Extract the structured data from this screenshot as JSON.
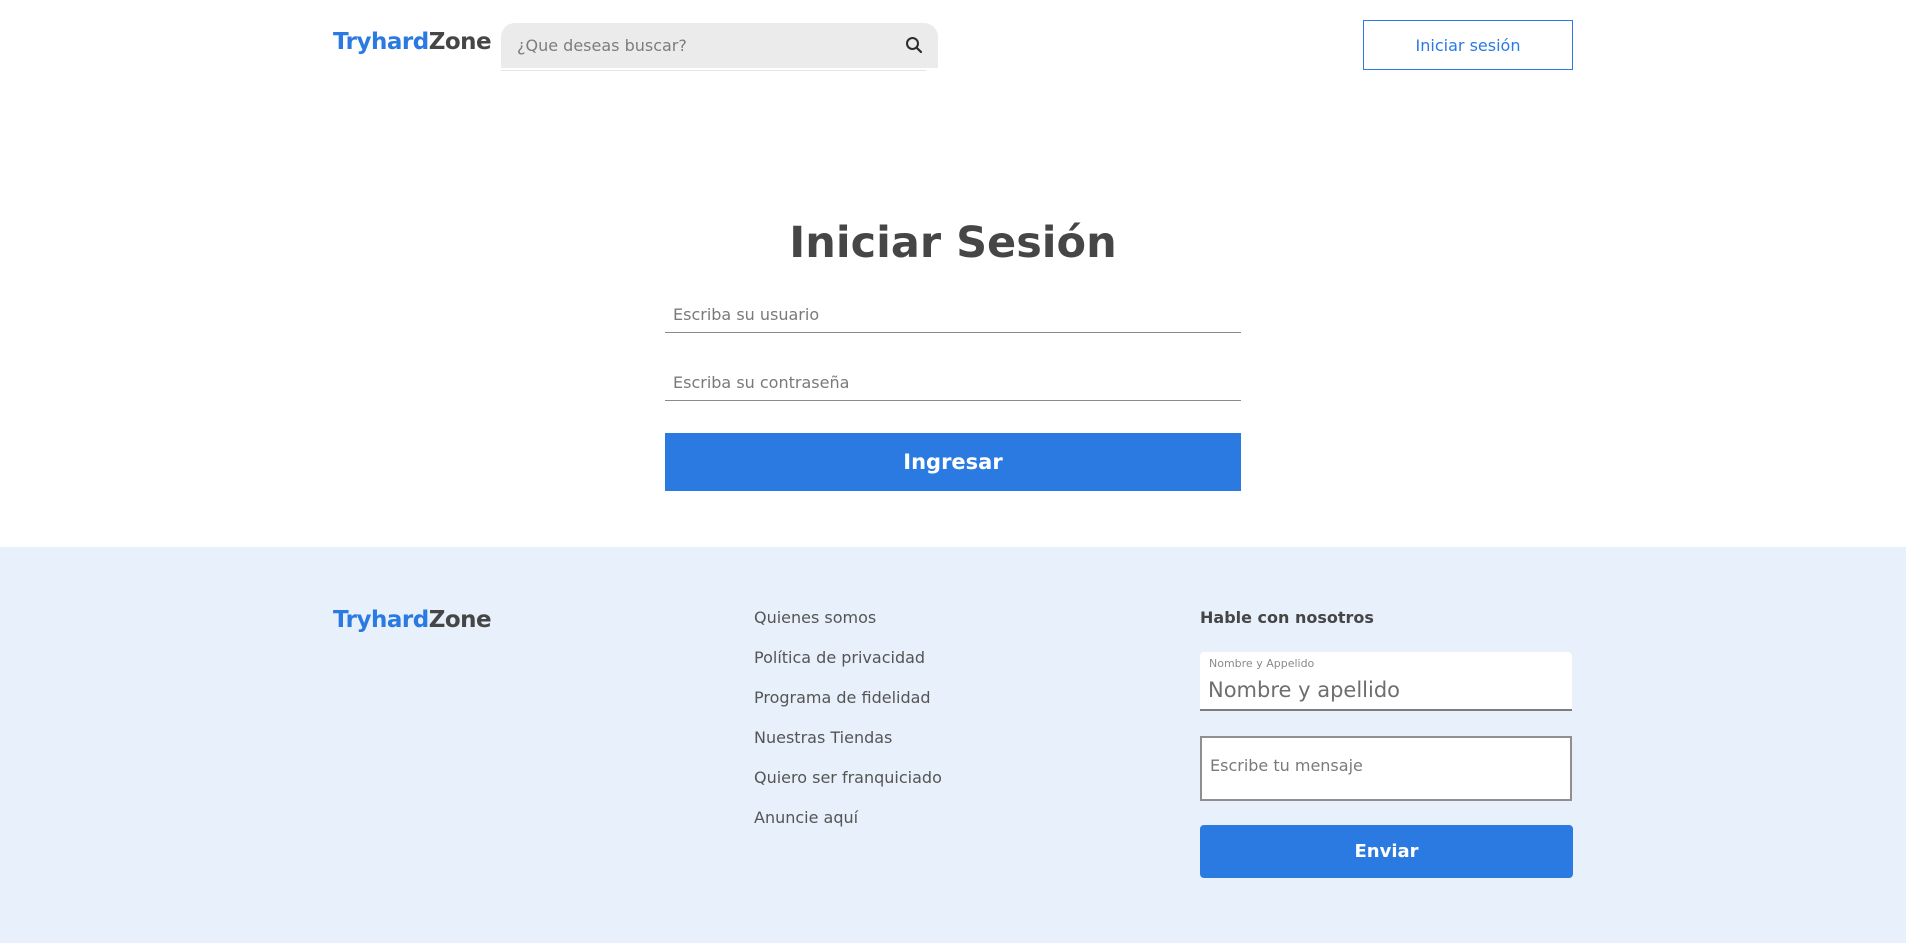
{
  "header": {
    "logo": {
      "part1": "Tryhard",
      "part2": "Zone"
    },
    "search": {
      "placeholder": "¿Que deseas buscar?",
      "icon": "search-icon"
    },
    "login_button": "Iniciar sesión"
  },
  "login": {
    "title": "Iniciar Sesión",
    "username_placeholder": "Escriba su usuario",
    "password_placeholder": "Escriba su contraseña",
    "submit_label": "Ingresar"
  },
  "footer": {
    "logo": {
      "part1": "Tryhard",
      "part2": "Zone"
    },
    "links": [
      "Quienes somos",
      "Política de privacidad",
      "Programa de fidelidad",
      "Nuestras Tiendas",
      "Quiero ser franquiciado",
      "Anuncie aquí"
    ],
    "contact": {
      "title": "Hable con nosotros",
      "name_label": "Nombre y Appelido",
      "name_placeholder": "Nombre y apellido",
      "message_placeholder": "Escribe tu mensaje",
      "send_label": "Enviar"
    }
  },
  "colors": {
    "accent": "#2a7ae2",
    "text": "#464646",
    "footer_bg": "#e8f0fb"
  }
}
